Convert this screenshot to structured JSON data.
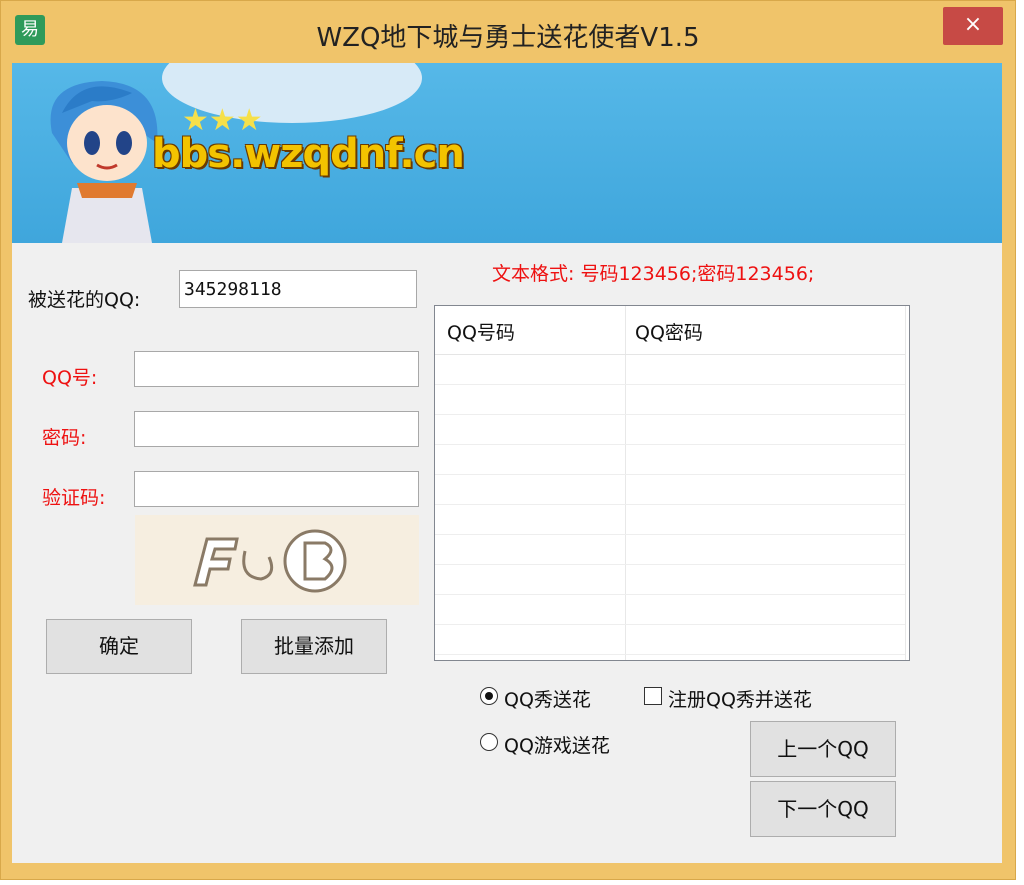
{
  "window": {
    "title": "WZQ地下城与勇士送花使者V1.5",
    "close_glyph": "×",
    "app_icon": "易"
  },
  "banner": {
    "site_text": "bbs.wzqdnf.cn",
    "stars": "★★★"
  },
  "form": {
    "recipient_label": "被送花的QQ:",
    "recipient_value": "345298118",
    "qq_label": "QQ号:",
    "qq_value": "",
    "password_label": "密码:",
    "password_value": "",
    "captcha_label": "验证码:",
    "captcha_value": ""
  },
  "hint": "文本格式: 号码123456;密码123456;",
  "table": {
    "columns": [
      "QQ号码",
      "QQ密码"
    ]
  },
  "buttons": {
    "confirm": "确定",
    "batch_add": "批量添加",
    "prev_qq": "上一个QQ",
    "next_qq": "下一个QQ"
  },
  "options": {
    "qqshow_label": "QQ秀送花",
    "qqshow_selected": true,
    "register_label": "注册QQ秀并送花",
    "register_checked": false,
    "qqgame_label": "QQ游戏送花",
    "qqgame_selected": false
  },
  "colors": {
    "title_bar": "#f0c46a",
    "accent_red": "#ee1111",
    "close": "#c74a45",
    "banner": "#3fa6dc"
  }
}
